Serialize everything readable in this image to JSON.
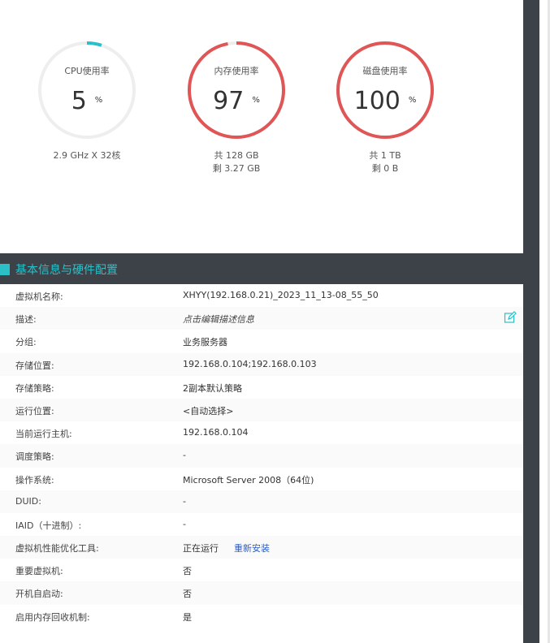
{
  "usage": {
    "cpu": {
      "label": "CPU使用率",
      "value": "5",
      "unit": "%",
      "fraction": 0.05,
      "sub": "2.9 GHz X 32核",
      "color": "#2bc0c8"
    },
    "memory": {
      "label": "内存使用率",
      "value": "97",
      "unit": "%",
      "fraction": 0.97,
      "total": "共 128 GB",
      "free": "剩 3.27 GB",
      "color": "#e05555"
    },
    "disk": {
      "label": "磁盘使用率",
      "value": "100",
      "unit": "%",
      "fraction": 1.0,
      "total": "共 1 TB",
      "free": "剩 0 B",
      "color": "#e05555"
    }
  },
  "section": {
    "title": "基本信息与硬件配置"
  },
  "info": {
    "rows": [
      {
        "label": "虚拟机名称:",
        "value": "XHYY(192.168.0.21)_2023_11_13-08_55_50"
      },
      {
        "label": "描述:",
        "value": "点击编辑描述信息"
      },
      {
        "label": "分组:",
        "value": "业务服务器"
      },
      {
        "label": "存储位置:",
        "value": "192.168.0.104;192.168.0.103"
      },
      {
        "label": "存储策略:",
        "value": "2副本默认策略"
      },
      {
        "label": "运行位置:",
        "value": "<自动选择>"
      },
      {
        "label": "当前运行主机:",
        "value": "192.168.0.104"
      },
      {
        "label": "调度策略:",
        "value": "-"
      },
      {
        "label": "操作系统:",
        "value": "Microsoft Server 2008（64位)"
      },
      {
        "label": "DUID:",
        "value": "-"
      },
      {
        "label": "IAID（十进制）:",
        "value": "-"
      },
      {
        "label": "虚拟机性能优化工具:",
        "value": "正在运行",
        "link": "重新安装"
      },
      {
        "label": "重要虚拟机:",
        "value": "否"
      },
      {
        "label": "开机自启动:",
        "value": "否"
      },
      {
        "label": "启用内存回收机制:",
        "value": "是"
      }
    ]
  },
  "icons": {
    "edit": "edit-icon"
  },
  "colors": {
    "accent": "#2bc0c8",
    "header_bg": "#3d4249",
    "track": "#eeeeee",
    "link": "#2a5fc8"
  }
}
